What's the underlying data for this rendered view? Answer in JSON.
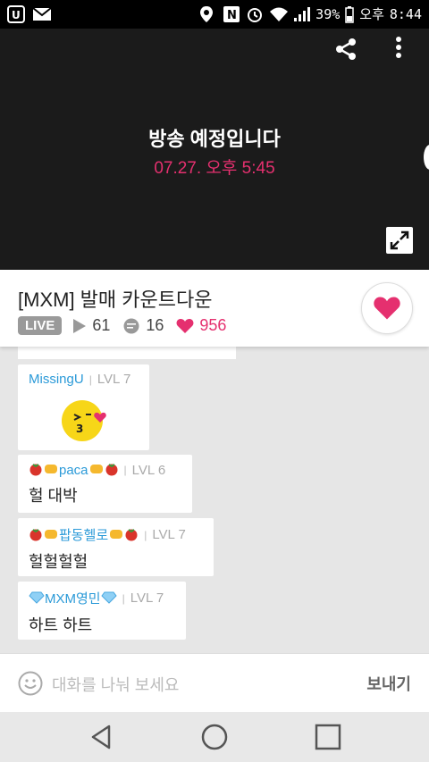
{
  "status_bar": {
    "battery": "39%",
    "ampm": "오후",
    "time": "8:44"
  },
  "player": {
    "title": "방송 예정입니다",
    "scheduled_time": "07.27. 오후 5:45"
  },
  "broadcast": {
    "title": "[MXM] 발매 카운트다운",
    "live_label": "LIVE",
    "views": "61",
    "comments": "16",
    "likes": "956"
  },
  "chat": {
    "messages": [
      {
        "user": "MissingU",
        "level": "LVL 7",
        "text": ""
      },
      {
        "user": "paca",
        "level": "LVL 6",
        "text": "헐 대박"
      },
      {
        "user": "팝동헬로",
        "level": "LVL 7",
        "text": "헐헐헐헐"
      },
      {
        "user": "MXM영민",
        "level": "LVL 7",
        "text": "하트 하트"
      }
    ]
  },
  "input": {
    "placeholder": "대화를 나눠 보세요",
    "send_label": "보내기"
  },
  "colors": {
    "accent": "#e5306f",
    "username": "#2b9ad8",
    "badge": "#9a9a9a"
  }
}
